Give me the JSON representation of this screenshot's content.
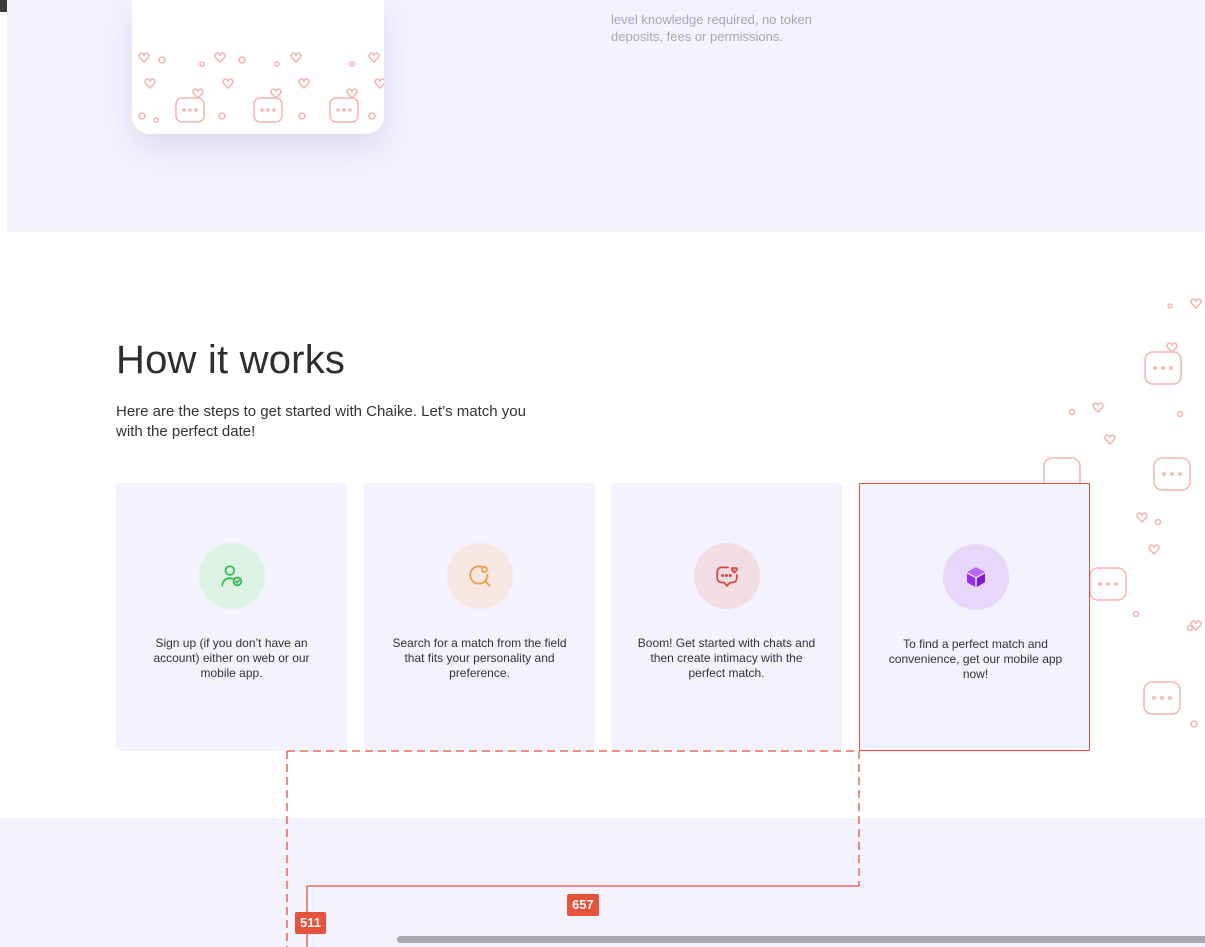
{
  "hero": {
    "description": "level knowledge required, no token deposits, fees or permissions."
  },
  "how_it_works": {
    "title": "How it works",
    "subtitle": "Here are the steps to get started with Chaike. Let’s match you with the perfect date!",
    "steps": [
      {
        "icon": "user-check-icon",
        "color": "#2fbf4a",
        "bg": "#dcf2e4",
        "text": "Sign up (if you don’t have an account) either on web or our mobile app."
      },
      {
        "icon": "search-icon",
        "color": "#f39a3c",
        "bg": "#f8e6e1",
        "text": "Search for a match from the field that fits your personality and preference."
      },
      {
        "icon": "chat-heart-icon",
        "color": "#e04040",
        "bg": "#f2dde4",
        "text": "Boom! Get started with chats and then create intimacy with the perfect match."
      },
      {
        "icon": "box-icon",
        "color": "#9b2cf2",
        "bg": "#e9d7fb",
        "text": "To find a perfect match and convenience, get our mobile app now!"
      }
    ]
  },
  "measure": {
    "width_label": "657",
    "height_label": "511"
  }
}
